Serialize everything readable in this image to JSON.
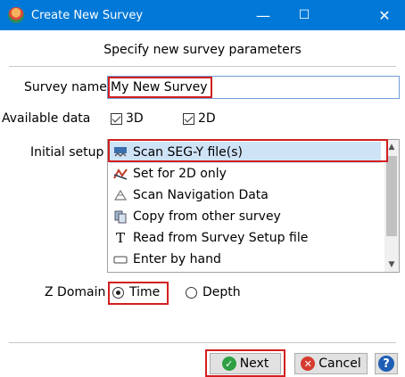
{
  "window": {
    "title": "Create New Survey",
    "minimize_glyph": "—",
    "maximize_glyph": "☐",
    "close_glyph": "✕"
  },
  "subtitle": "Specify new survey parameters",
  "survey_name": {
    "label": "Survey name",
    "value": "My New Survey"
  },
  "available_data": {
    "label": "Available data",
    "options": [
      {
        "label": "3D",
        "checked": true
      },
      {
        "label": "2D",
        "checked": true
      }
    ]
  },
  "initial_setup": {
    "label": "Initial setup",
    "items": [
      {
        "label": "Scan SEG-Y file(s)",
        "icon": "segy-icon",
        "selected": true
      },
      {
        "label": "Set for 2D only",
        "icon": "2d-line-icon",
        "selected": false
      },
      {
        "label": "Scan Navigation Data",
        "icon": "navigation-icon",
        "selected": false
      },
      {
        "label": "Copy from other survey",
        "icon": "copy-icon",
        "selected": false
      },
      {
        "label": "Read from Survey Setup file",
        "icon": "text-icon",
        "selected": false
      },
      {
        "label": "Enter by hand",
        "icon": "keyboard-icon",
        "selected": false
      }
    ]
  },
  "z_domain": {
    "label": "Z Domain",
    "options": [
      {
        "label": "Time",
        "selected": true
      },
      {
        "label": "Depth",
        "selected": false
      }
    ]
  },
  "buttons": {
    "next": "Next",
    "cancel": "Cancel",
    "help": "?"
  },
  "colors": {
    "titlebar": "#0078d7",
    "highlight": "#d21f1f",
    "selection": "#cfe3f7"
  }
}
